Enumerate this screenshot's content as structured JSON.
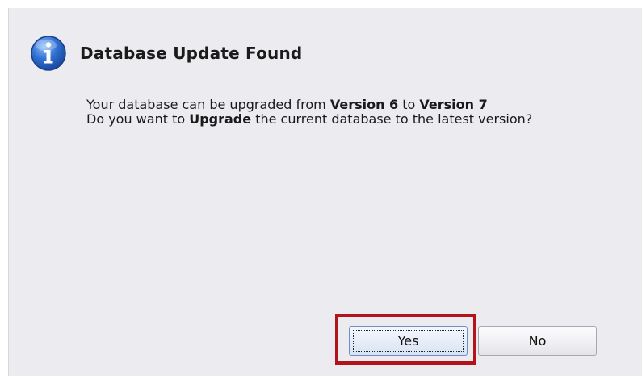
{
  "dialog": {
    "title": "Database Update Found",
    "icon": "info-icon",
    "message": {
      "line1_prefix": "Your database can be upgraded from ",
      "from_version": "Version 6",
      "line1_middle": " to ",
      "to_version": "Version 7",
      "line2_prefix": "Do you want to ",
      "action": "Upgrade",
      "line2_suffix": " the current database to the latest version?"
    },
    "buttons": {
      "yes_label": "Yes",
      "no_label": "No"
    }
  },
  "colors": {
    "dialog_background": "#ececf0",
    "info_icon_blue": "#2f6fd0",
    "highlight_border": "#b3131a"
  }
}
